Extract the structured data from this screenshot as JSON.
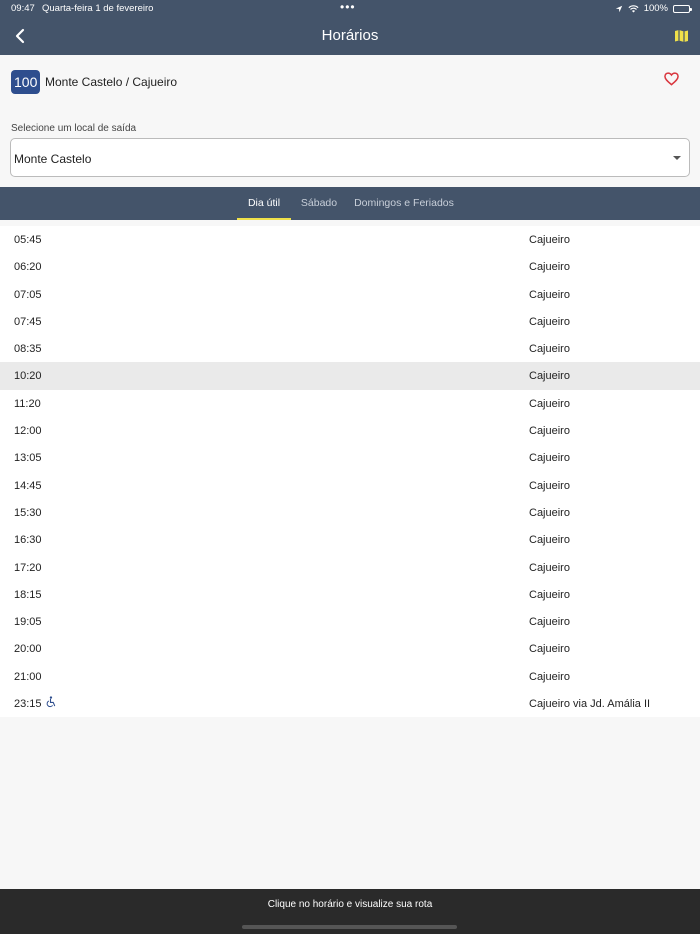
{
  "status": {
    "time": "09:47",
    "date": "Quarta-feira 1 de fevereiro",
    "battery": "100%"
  },
  "nav": {
    "title": "Horários",
    "back_icon": "chevron-left-icon",
    "map_icon": "map-icon"
  },
  "route": {
    "number": "100",
    "name": "Monte Castelo / Cajueiro",
    "favorite_icon": "heart-outline-icon"
  },
  "departure": {
    "label": "Selecione um local de saída",
    "value": "Monte Castelo"
  },
  "tabs": [
    {
      "label": "Dia útil",
      "active": true
    },
    {
      "label": "Sábado",
      "active": false
    },
    {
      "label": "Domingos e Feriados",
      "active": false
    }
  ],
  "schedule": [
    {
      "time": "05:45",
      "dest": "Cajueiro"
    },
    {
      "time": "06:20",
      "dest": "Cajueiro"
    },
    {
      "time": "07:05",
      "dest": "Cajueiro"
    },
    {
      "time": "07:45",
      "dest": "Cajueiro"
    },
    {
      "time": "08:35",
      "dest": "Cajueiro"
    },
    {
      "time": "10:20",
      "dest": "Cajueiro",
      "highlight": true
    },
    {
      "time": "11:20",
      "dest": "Cajueiro"
    },
    {
      "time": "12:00",
      "dest": "Cajueiro"
    },
    {
      "time": "13:05",
      "dest": "Cajueiro"
    },
    {
      "time": "14:45",
      "dest": "Cajueiro"
    },
    {
      "time": "15:30",
      "dest": "Cajueiro"
    },
    {
      "time": "16:30",
      "dest": "Cajueiro"
    },
    {
      "time": "17:20",
      "dest": "Cajueiro"
    },
    {
      "time": "18:15",
      "dest": "Cajueiro"
    },
    {
      "time": "19:05",
      "dest": "Cajueiro"
    },
    {
      "time": "20:00",
      "dest": "Cajueiro"
    },
    {
      "time": "21:00",
      "dest": "Cajueiro"
    },
    {
      "time": "23:15",
      "dest": "Cajueiro via Jd. Amália II",
      "accessible": true
    }
  ],
  "footer": {
    "text": "Clique no horário e visualize sua rota"
  },
  "colors": {
    "header": "#44546a",
    "badge": "#2e4e8e",
    "tab_indicator": "#f0e14a",
    "heart": "#d9363e",
    "map_icon": "#f0e14a"
  }
}
